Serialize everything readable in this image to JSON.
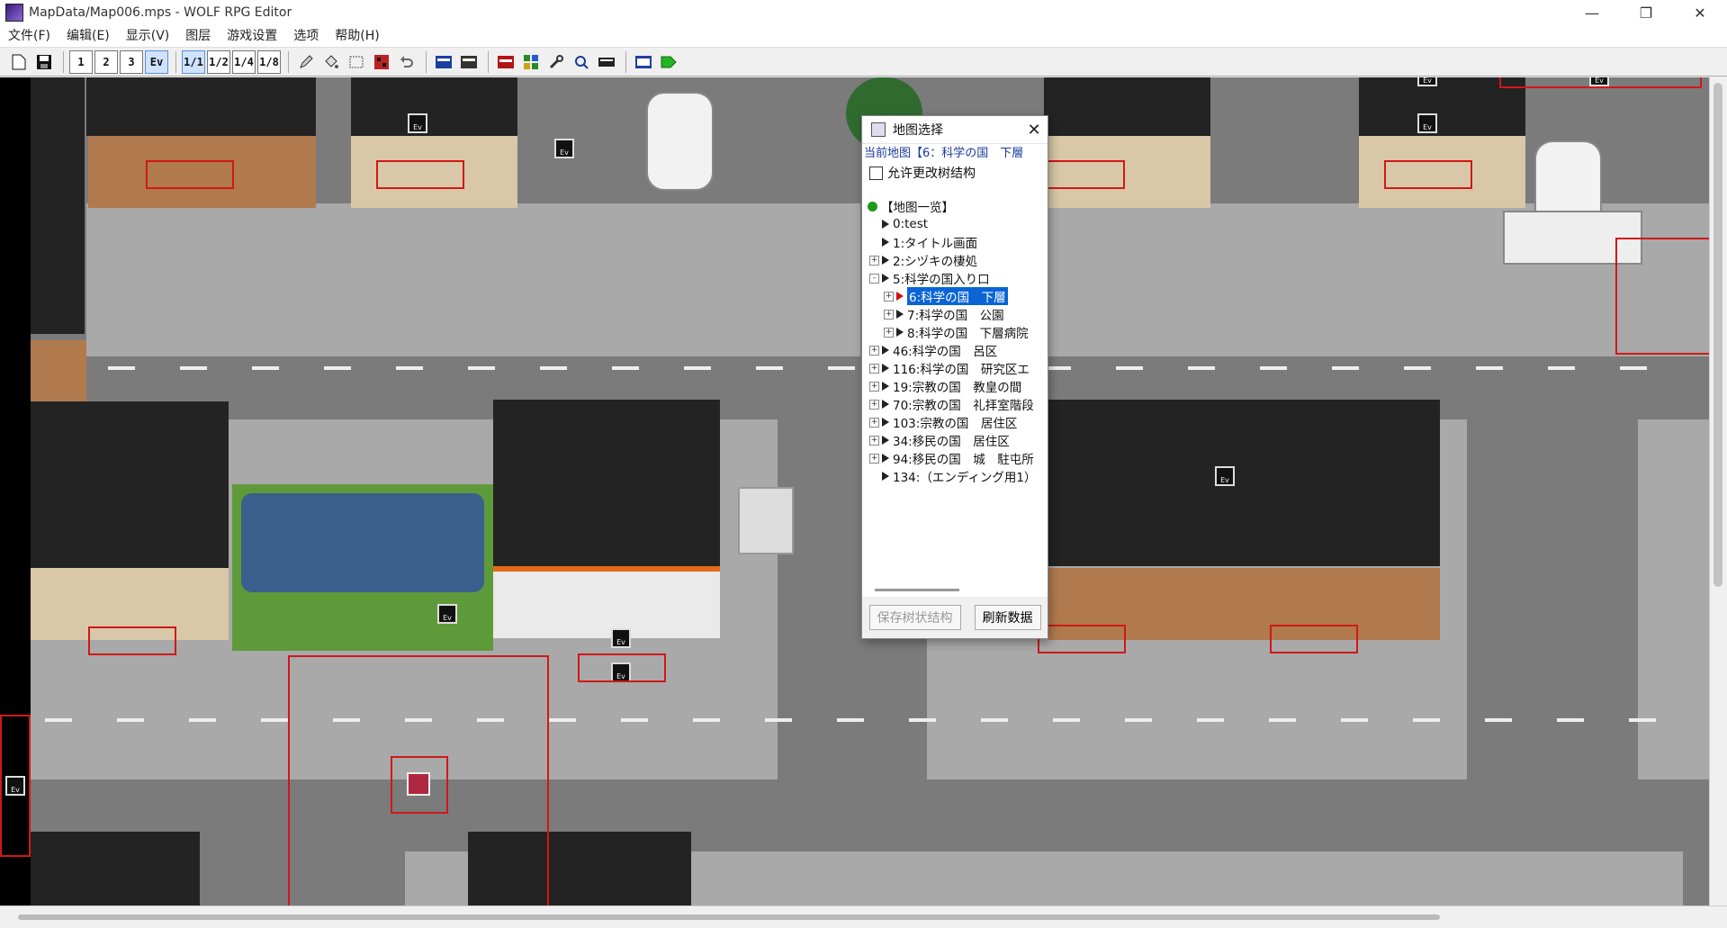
{
  "window": {
    "title": "MapData/Map006.mps - WOLF RPG Editor",
    "minimize": "—",
    "restore": "❐",
    "close": "✕"
  },
  "menu": [
    "文件(F)",
    "编辑(E)",
    "显示(V)",
    "图层",
    "游戏设置",
    "选项",
    "帮助(H)"
  ],
  "toolbar": {
    "layer1": "1",
    "layer2": "2",
    "layer3": "3",
    "event": "Ev",
    "zoom1": "1/1",
    "zoom2": "1/2",
    "zoom4": "1/4",
    "zoom8": "1/8"
  },
  "event_marker": "Ev",
  "colors": {
    "selection": "#0a64d6",
    "event_box": "#d01818",
    "tree_root": "#1a9b1a"
  },
  "dialog": {
    "title": "地图选择",
    "close": "✕",
    "current_map": "当前地图【6：科学の国　下層",
    "allow_change_label": "允许更改树结构",
    "tree": [
      {
        "label": "【地图一览】",
        "level": 0,
        "icon": "green-dot",
        "expander": ""
      },
      {
        "label": "0:test",
        "level": 1,
        "icon": "triangle",
        "expander": ""
      },
      {
        "label": "1:タイトル画面",
        "level": 1,
        "icon": "triangle",
        "expander": ""
      },
      {
        "label": "2:シヅキの棲処",
        "level": 1,
        "icon": "triangle",
        "expander": "+"
      },
      {
        "label": "5:科学の国入り口",
        "level": 1,
        "icon": "triangle",
        "expander": "-"
      },
      {
        "label": "6:科学の国　下層",
        "level": 2,
        "icon": "red-triangle",
        "expander": "+",
        "selected": true
      },
      {
        "label": "7:科学の国　公園",
        "level": 2,
        "icon": "triangle",
        "expander": "+"
      },
      {
        "label": "8:科学の国　下層病院",
        "level": 2,
        "icon": "triangle",
        "expander": "+"
      },
      {
        "label": "46:科学の国　呂区",
        "level": 1,
        "icon": "triangle",
        "expander": "+"
      },
      {
        "label": "116:科学の国　研究区エ",
        "level": 1,
        "icon": "triangle",
        "expander": "+"
      },
      {
        "label": "19:宗教の国　教皇の間",
        "level": 1,
        "icon": "triangle",
        "expander": "+"
      },
      {
        "label": "70:宗教の国　礼拝室階段",
        "level": 1,
        "icon": "triangle",
        "expander": "+"
      },
      {
        "label": "103:宗教の国　居住区",
        "level": 1,
        "icon": "triangle",
        "expander": "+"
      },
      {
        "label": "34:移民の国　居住区",
        "level": 1,
        "icon": "triangle",
        "expander": "+"
      },
      {
        "label": "94:移民の国　城　駐屯所",
        "level": 1,
        "icon": "triangle",
        "expander": "+"
      },
      {
        "label": "134:（エンディング用1）",
        "level": 1,
        "icon": "triangle",
        "expander": ""
      }
    ],
    "save_button": "保存树状结构",
    "refresh_button": "刷新数据"
  }
}
